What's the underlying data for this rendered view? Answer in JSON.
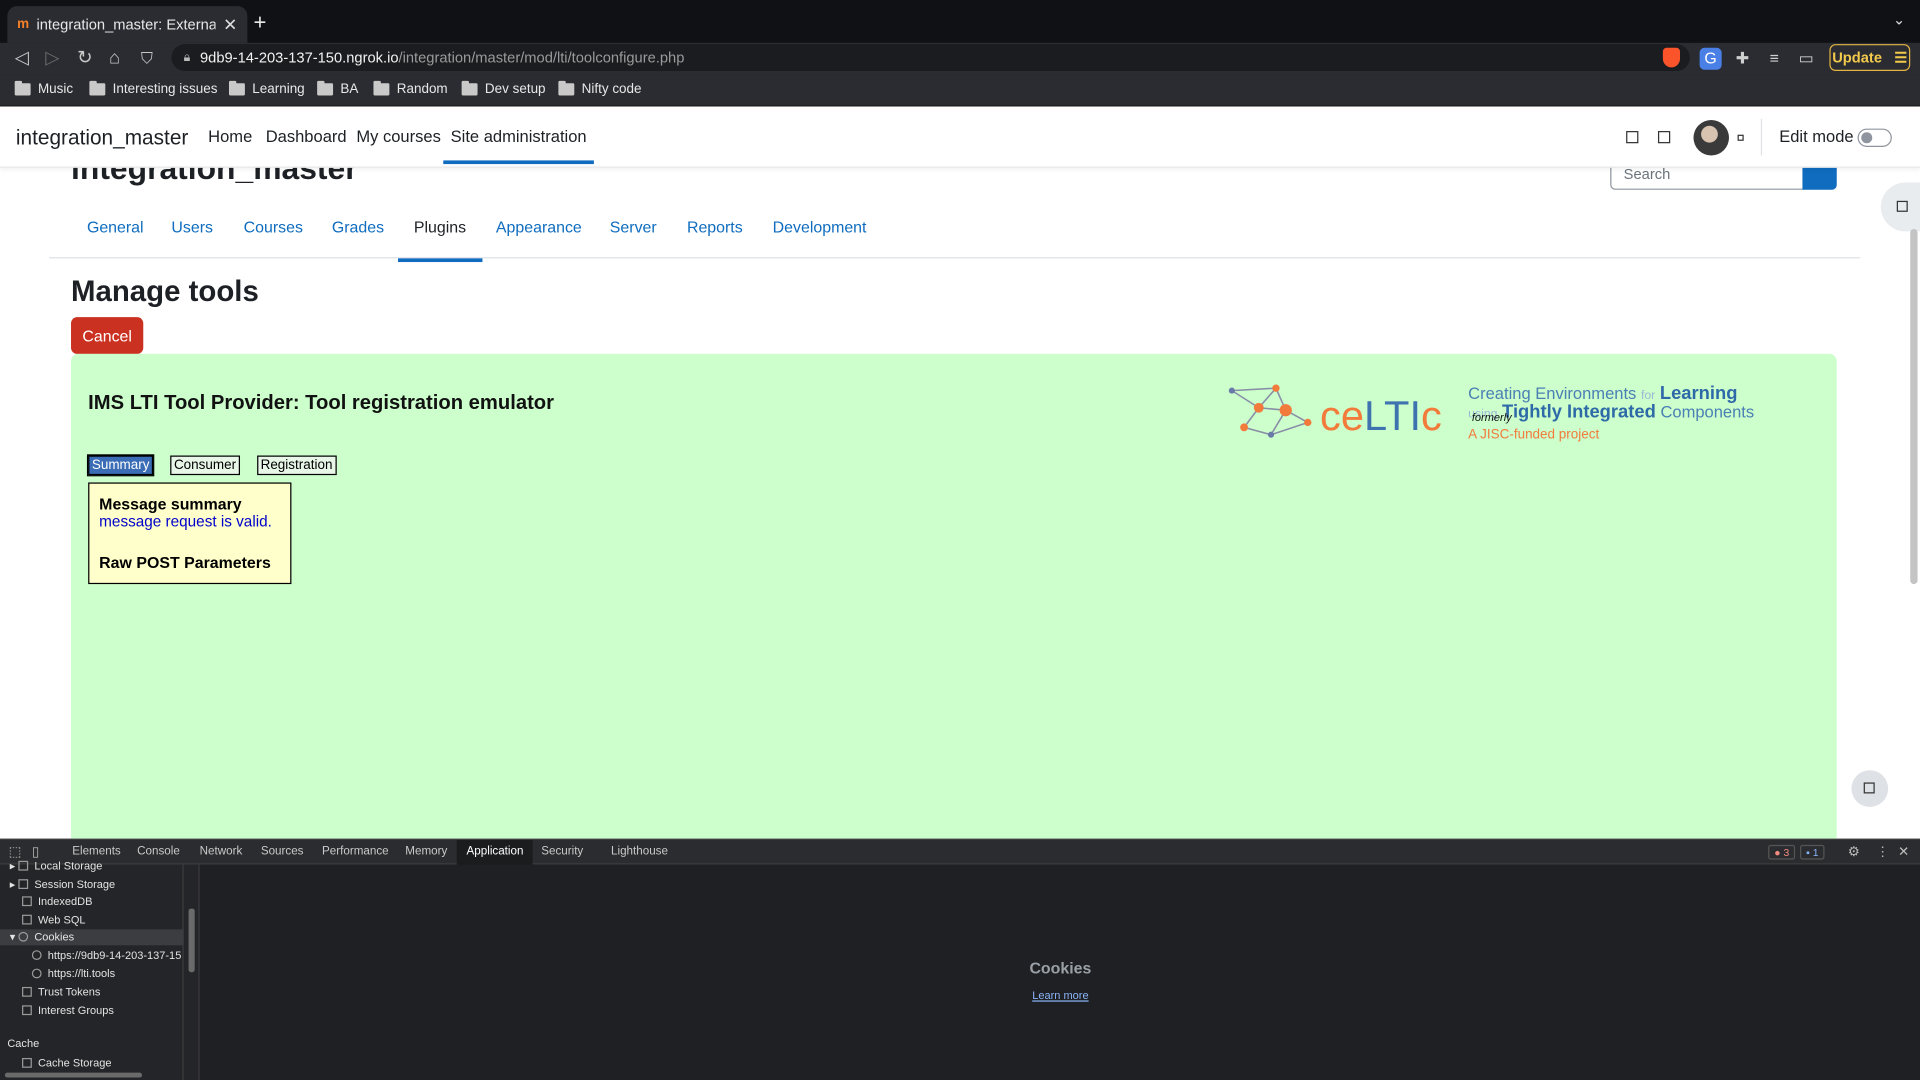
{
  "browser": {
    "tab_title": "integration_master: External to",
    "tab_favicon": "m",
    "new_tab": "+",
    "url_host": "9db9-14-203-137-150.ngrok.io",
    "url_path": "/integration/master/mod/lti/toolconfigure.php",
    "update_label": "Update",
    "bookmarks": [
      "Music",
      "Interesting issues",
      "Learning",
      "BA",
      "Random",
      "Dev setup",
      "Nifty code"
    ]
  },
  "moodle": {
    "brand": "integration_master",
    "nav": [
      "Home",
      "Dashboard",
      "My courses",
      "Site administration"
    ],
    "edit_mode_label": "Edit mode",
    "site_title": "integration_master",
    "search_placeholder": "Search",
    "admin_tabs": [
      "General",
      "Users",
      "Courses",
      "Grades",
      "Plugins",
      "Appearance",
      "Server",
      "Reports",
      "Development"
    ],
    "heading": "Manage tools",
    "cancel_label": "Cancel"
  },
  "tool": {
    "title": "IMS LTI Tool Provider: Tool registration emulator",
    "buttons": [
      "Summary",
      "Consumer",
      "Registration"
    ],
    "message_heading": "Message summary",
    "message_status": "message request is valid.",
    "raw_heading": "Raw POST Parameters",
    "logo_word": "ceLTIc",
    "logo_line1_a": "Creating Environments",
    "logo_line1_for": "for",
    "logo_line1_b": "Learning",
    "logo_line2_using": "using",
    "logo_line2_b": "Tightly Integrated",
    "logo_line2_c": "Components",
    "logo_formerly": "formerly",
    "logo_line3": "A JISC-funded project"
  },
  "devtools": {
    "tabs": [
      "Elements",
      "Console",
      "Network",
      "Sources",
      "Performance",
      "Memory",
      "Application",
      "Security",
      "Lighthouse"
    ],
    "active_tab": "Application",
    "error_count": "3",
    "message_count": "1",
    "sidebar": [
      "Local Storage",
      "Session Storage",
      "IndexedDB",
      "Web SQL",
      "Cookies",
      "https://9db9-14-203-137-15",
      "https://lti.tools",
      "Trust Tokens",
      "Interest Groups",
      "Cache",
      "Cache Storage"
    ],
    "panel_title": "Cookies",
    "learn_more": "Learn more"
  },
  "colors": {
    "moodle_blue": "#0f6cbf",
    "cancel_red": "#ca3120",
    "tool_bg": "#ccffcc",
    "message_bg": "#ffffcc",
    "update_accent": "#e3b341"
  }
}
